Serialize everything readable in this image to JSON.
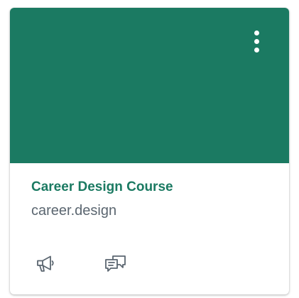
{
  "colors": {
    "hero": "#1b7a62",
    "title": "#1b7a62",
    "icon": "#5b6670"
  },
  "card": {
    "title": "Career Design Course",
    "subtitle": "career.design",
    "menu_icon": "kebab-vertical-icon",
    "actions": [
      {
        "icon": "megaphone-icon"
      },
      {
        "icon": "discussion-bubbles-icon"
      }
    ]
  }
}
